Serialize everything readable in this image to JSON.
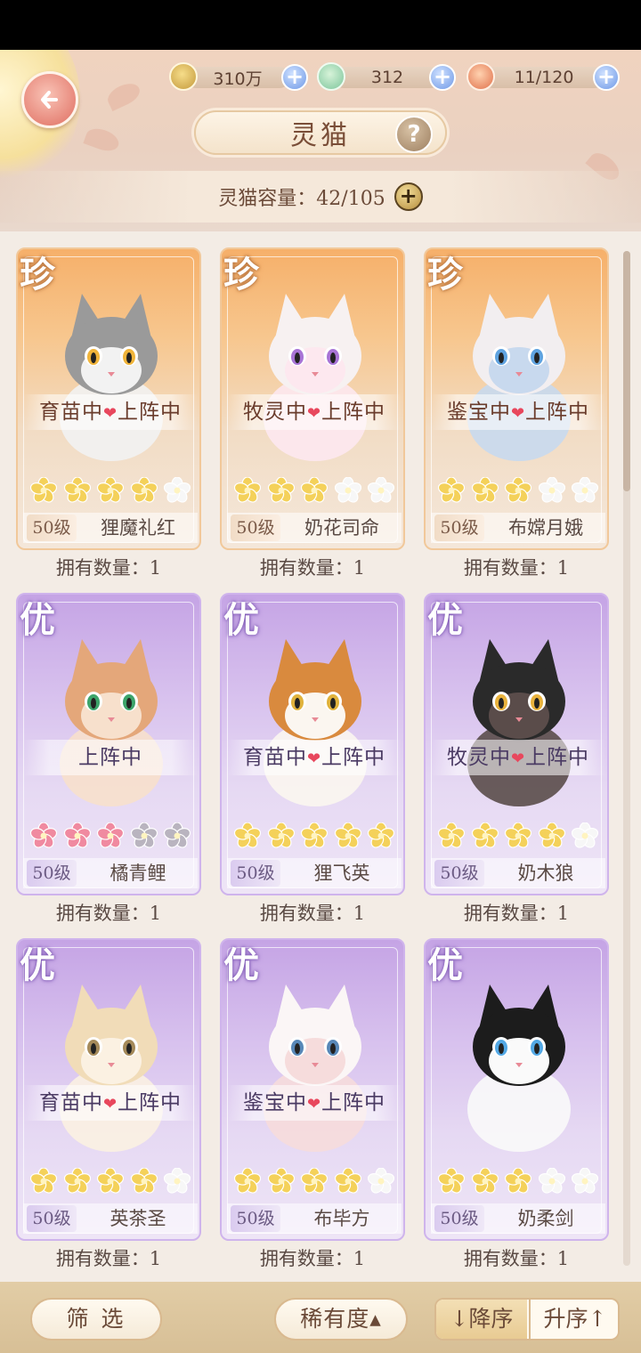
{
  "header": {
    "title": "灵猫",
    "resources": [
      {
        "icon": "paw-coin-icon",
        "value": "310万"
      },
      {
        "icon": "jade-fish-icon",
        "value": "312"
      },
      {
        "icon": "shrimp-food-icon",
        "value": "11/120"
      }
    ],
    "capacity_label": "灵猫容量：42/105"
  },
  "cards": [
    {
      "grade": "珍",
      "rarity": "rare",
      "status": "育苗中|上阵中",
      "stars_filled": 4,
      "stars_total": 5,
      "level": "50级",
      "name": "狸魔礼红",
      "owned": "拥有数量：1"
    },
    {
      "grade": "珍",
      "rarity": "rare",
      "status": "牧灵中|上阵中",
      "stars_filled": 3,
      "stars_total": 5,
      "level": "50级",
      "name": "奶花司命",
      "owned": "拥有数量：1"
    },
    {
      "grade": "珍",
      "rarity": "rare",
      "status": "鉴宝中|上阵中",
      "stars_filled": 3,
      "stars_total": 5,
      "level": "50级",
      "name": "布嫦月娥",
      "owned": "拥有数量：1"
    },
    {
      "grade": "优",
      "rarity": "good",
      "status": "上阵中",
      "stars_filled": 3,
      "stars_total": 5,
      "star_color": "pink",
      "level": "50级",
      "name": "橘青鲤",
      "owned": "拥有数量：1"
    },
    {
      "grade": "优",
      "rarity": "good",
      "status": "育苗中|上阵中",
      "stars_filled": 5,
      "stars_total": 5,
      "level": "50级",
      "name": "狸飞英",
      "owned": "拥有数量：1"
    },
    {
      "grade": "优",
      "rarity": "good",
      "status": "牧灵中|上阵中",
      "stars_filled": 4,
      "stars_total": 5,
      "level": "50级",
      "name": "奶木狼",
      "owned": "拥有数量：1"
    },
    {
      "grade": "优",
      "rarity": "good",
      "status": "育苗中|上阵中",
      "stars_filled": 4,
      "stars_total": 5,
      "level": "50级",
      "name": "英茶圣",
      "owned": "拥有数量：1"
    },
    {
      "grade": "优",
      "rarity": "good",
      "status": "鉴宝中|上阵中",
      "stars_filled": 4,
      "stars_total": 5,
      "level": "50级",
      "name": "布毕方",
      "owned": "拥有数量：1"
    },
    {
      "grade": "优",
      "rarity": "good",
      "status": "",
      "stars_filled": 3,
      "stars_total": 5,
      "level": "50级",
      "name": "奶柔剑",
      "owned": "拥有数量：1"
    }
  ],
  "toolbar": {
    "filter_label": "筛 选",
    "rarity_label": "稀有度▴",
    "desc_label": "↓降序",
    "asc_label": "升序↑"
  },
  "colors": {
    "rare_card": "#f6b06a",
    "good_card": "#c5a4e5",
    "star_gold": "#f4d15a",
    "star_pink": "#f08aa0",
    "heart": "#e8475d"
  }
}
